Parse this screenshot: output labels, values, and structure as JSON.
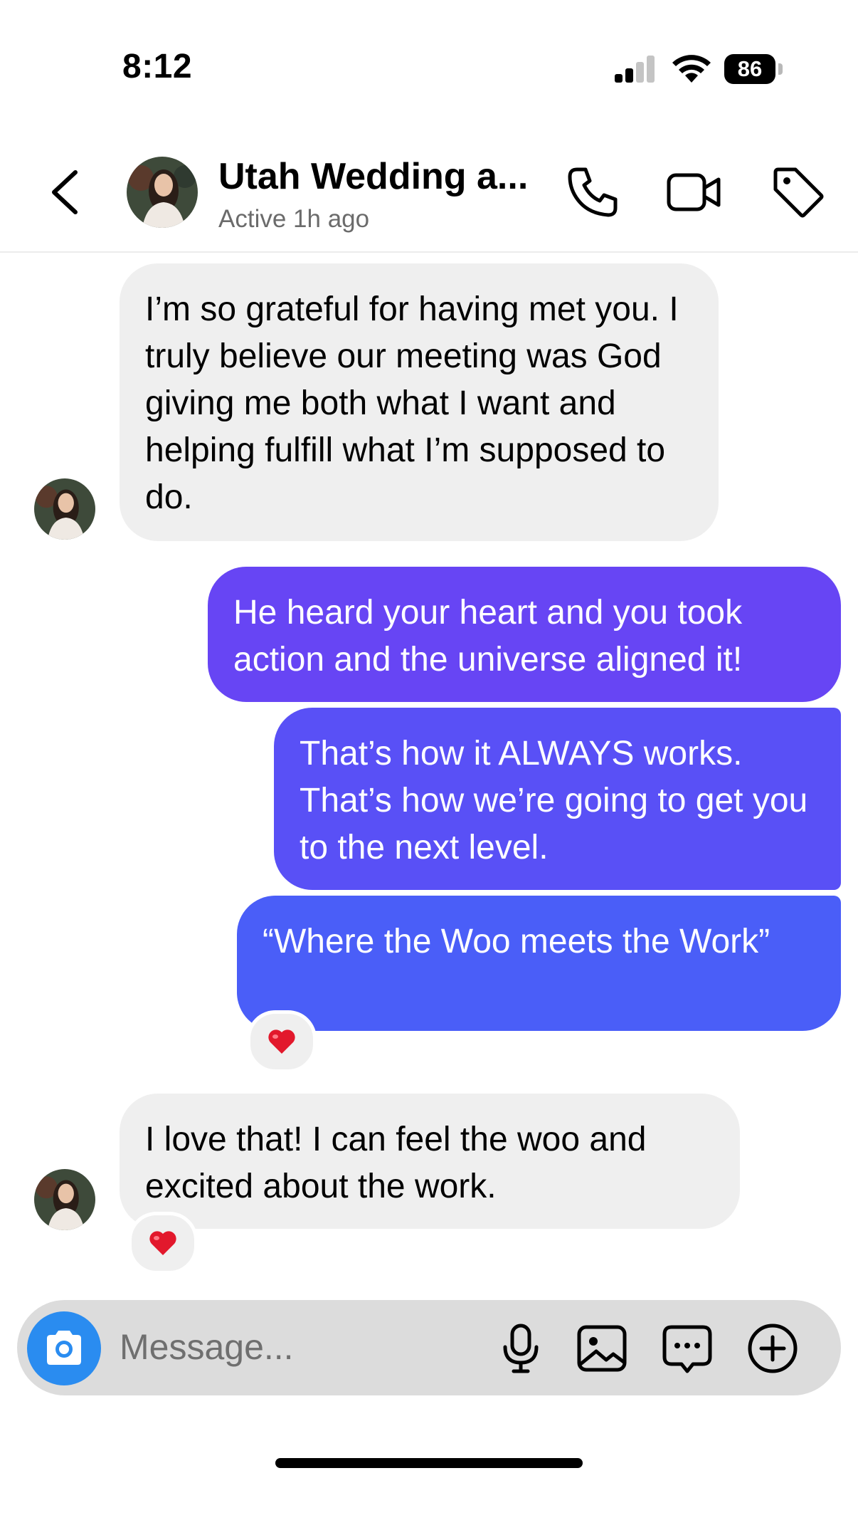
{
  "status_bar": {
    "time": "8:12",
    "battery": "86"
  },
  "header": {
    "contact_name": "Utah Wedding a...",
    "active_status": "Active 1h ago"
  },
  "messages": [
    {
      "direction": "incoming",
      "text": "I’m so grateful for having met you. I truly believe our meeting was God giving me both what I want and helping fulfill what I’m supposed to do."
    },
    {
      "direction": "outgoing",
      "text": "He heard your heart and you took action and the universe aligned it!"
    },
    {
      "direction": "outgoing",
      "text": "That’s how it ALWAYS works. That’s how we’re going to get you to the next level."
    },
    {
      "direction": "outgoing",
      "text": "“Where the Woo meets the Work”",
      "reaction": "heart"
    },
    {
      "direction": "incoming",
      "text": "I love that! I can feel the woo and excited about the work.",
      "reaction": "heart"
    }
  ],
  "composer": {
    "placeholder": "Message..."
  },
  "colors": {
    "incoming_bubble": "#efefef",
    "outgoing_top": "#6a44f5",
    "outgoing_bottom": "#4a5cf8",
    "camera_button": "#2a8cf0"
  }
}
